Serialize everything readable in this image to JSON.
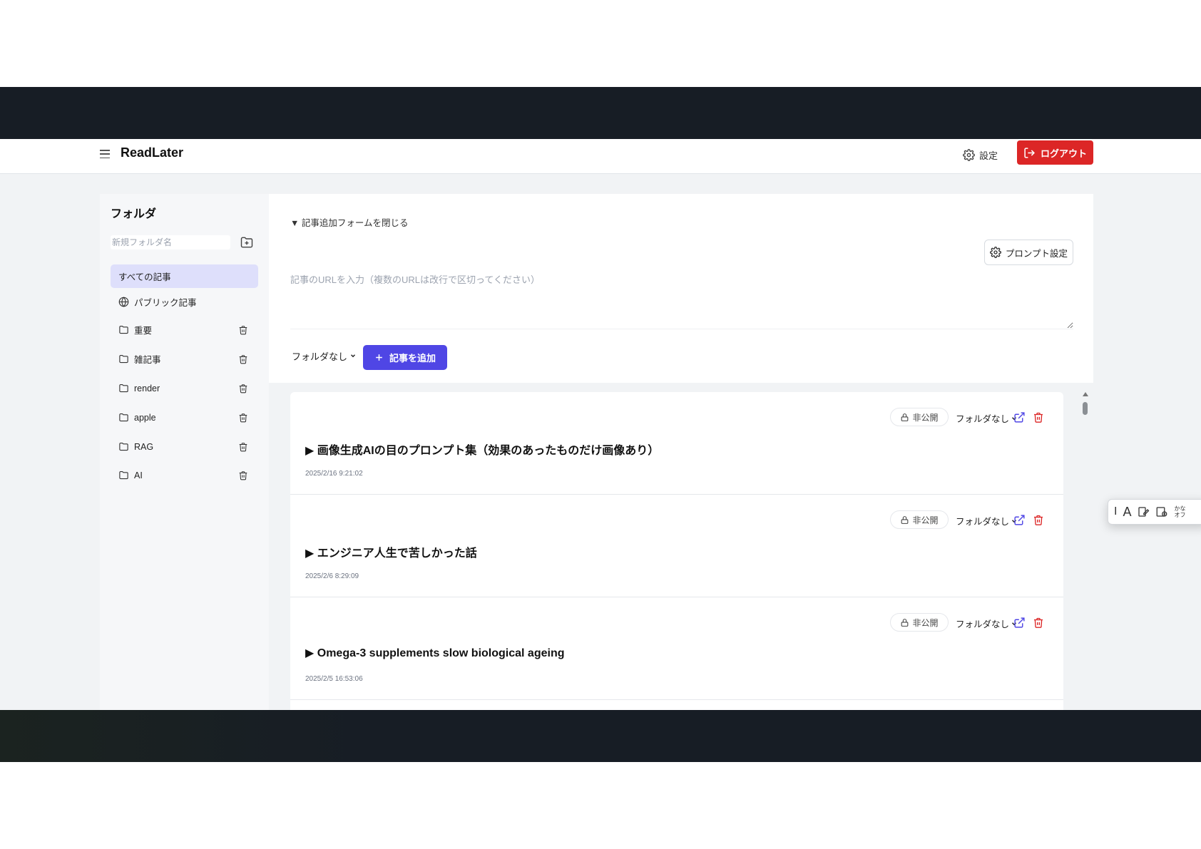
{
  "header": {
    "app_title": "ReadLater",
    "settings_label": "設定",
    "logout_label": "ログアウト"
  },
  "sidebar": {
    "title": "フォルダ",
    "new_folder_placeholder": "新規フォルダ名",
    "items": [
      {
        "label": "すべての記事",
        "icon": "none",
        "active": true
      },
      {
        "label": "パブリック記事",
        "icon": "globe-icon"
      },
      {
        "label": "重要",
        "icon": "folder-icon"
      },
      {
        "label": "雑記事",
        "icon": "folder-icon"
      },
      {
        "label": "render",
        "icon": "folder-icon"
      },
      {
        "label": "apple",
        "icon": "folder-icon"
      },
      {
        "label": "RAG",
        "icon": "folder-icon"
      },
      {
        "label": "AI",
        "icon": "folder-icon"
      }
    ]
  },
  "form": {
    "toggle_label": "▼ 記事追加フォームを閉じる",
    "prompt_settings_label": "プロンプト設定",
    "url_placeholder": "記事のURLを入力（複数のURLは改行で区切ってください）",
    "folder_select_value": "フォルダなし",
    "add_button_label": "記事を追加"
  },
  "articles": [
    {
      "title": "▶ 画像生成AIの目のプロンプト集（効果のあったものだけ画像あり）",
      "date": "2025/2/16 9:21:02",
      "privacy": "非公開",
      "folder": "フォルダなし"
    },
    {
      "title": "▶ エンジニア人生で苦しかった話",
      "date": "2025/2/6 8:29:09",
      "privacy": "非公開",
      "folder": "フォルダなし"
    },
    {
      "title": "▶ Omega-3 supplements slow biological ageing",
      "date": "2025/2/5 16:53:06",
      "privacy": "非公開",
      "folder": "フォルダなし"
    }
  ],
  "float_toolbar": {
    "text_label": "A",
    "kana_label_1": "かな",
    "kana_label_2": "オフ"
  },
  "colors": {
    "accent": "#4f46e5",
    "danger": "#dc2626",
    "active_bg": "#dedffb",
    "frame_dark": "#171d25"
  }
}
